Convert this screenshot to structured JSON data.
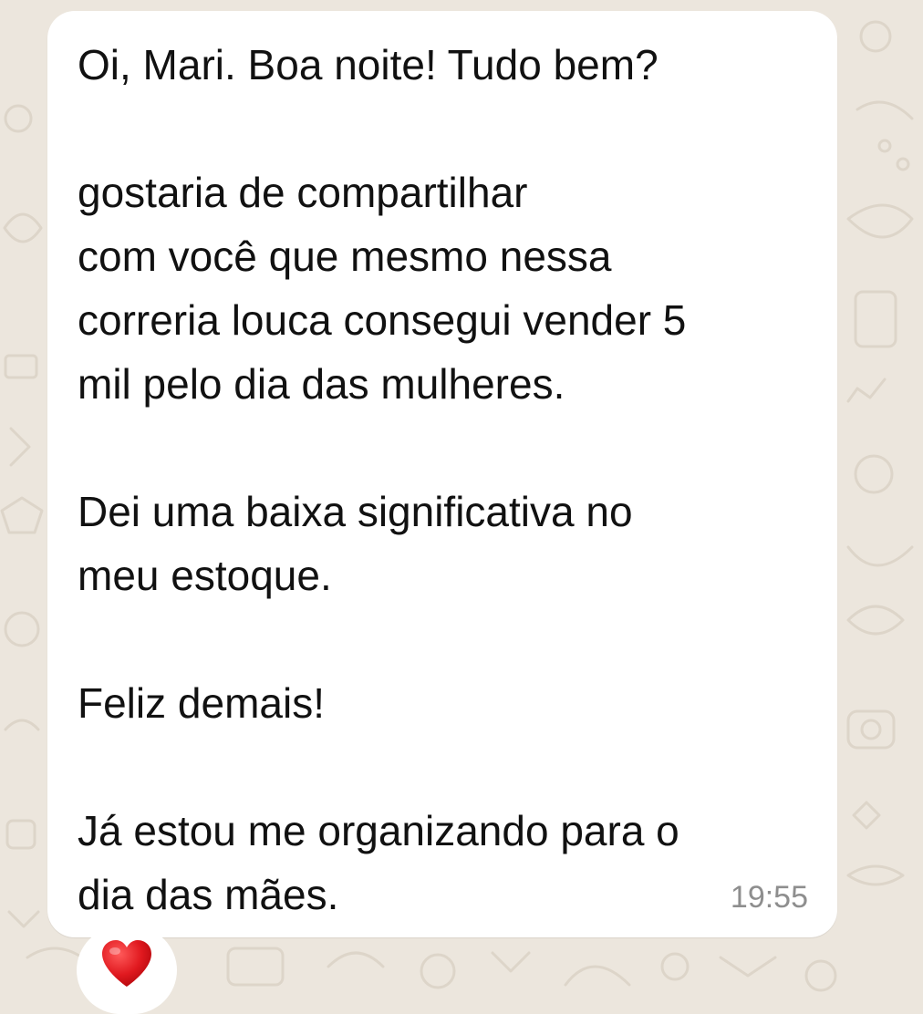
{
  "chat": {
    "background_color": "#ece6dd",
    "bubble_color": "#ffffff",
    "message": {
      "paragraphs": [
        "Oi, Mari. Boa noite! Tudo bem?",
        "gostaria de compartilhar\ncom você que mesmo nessa\ncorreria louca consegui vender 5\nmil pelo dia das mulheres.",
        "Dei uma baixa significativa no\nmeu estoque.",
        "Feliz demais!",
        "Já estou me organizando para o\ndia das mães."
      ],
      "time": "19:55"
    },
    "reaction": {
      "icon": "red-heart-icon",
      "color": "#e0191f"
    }
  }
}
